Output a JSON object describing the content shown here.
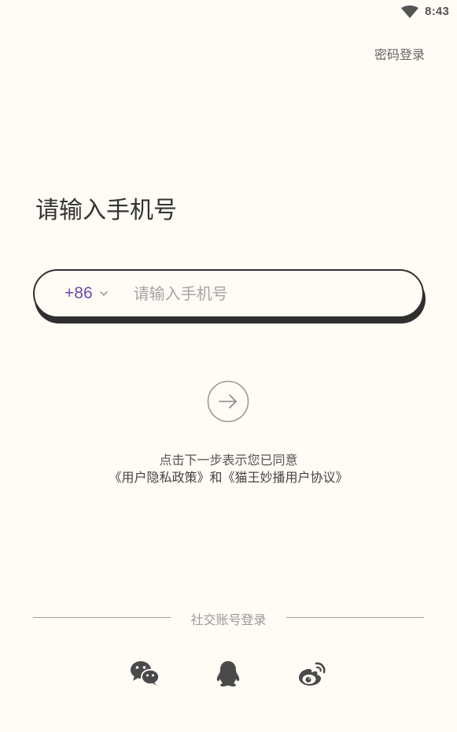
{
  "status_bar": {
    "time": "8:43",
    "wifi_icon": "wifi-icon"
  },
  "header": {
    "password_login_label": "密码登录"
  },
  "main": {
    "title": "请输入手机号",
    "phone_field": {
      "country_code": "+86",
      "country_dropdown_icon": "chevron-down-icon",
      "placeholder": "请输入手机号",
      "value": ""
    },
    "next_button_icon": "arrow-right-circle-icon",
    "agreement": {
      "line1": "点击下一步表示您已同意",
      "privacy_policy": "《用户隐私政策》",
      "connector": "和",
      "user_agreement": "《猫王妙播用户协议》"
    }
  },
  "social_login": {
    "label": "社交账号登录",
    "providers": [
      {
        "name": "WeChat",
        "icon": "wechat-icon"
      },
      {
        "name": "QQ",
        "icon": "qq-icon"
      },
      {
        "name": "Weibo",
        "icon": "weibo-icon"
      }
    ]
  },
  "colors": {
    "background": "#FFFBF5",
    "accent_country_code": "#6B4BA8",
    "input_border": "#2F2F2F",
    "icon_gray": "#4A4A4A"
  }
}
